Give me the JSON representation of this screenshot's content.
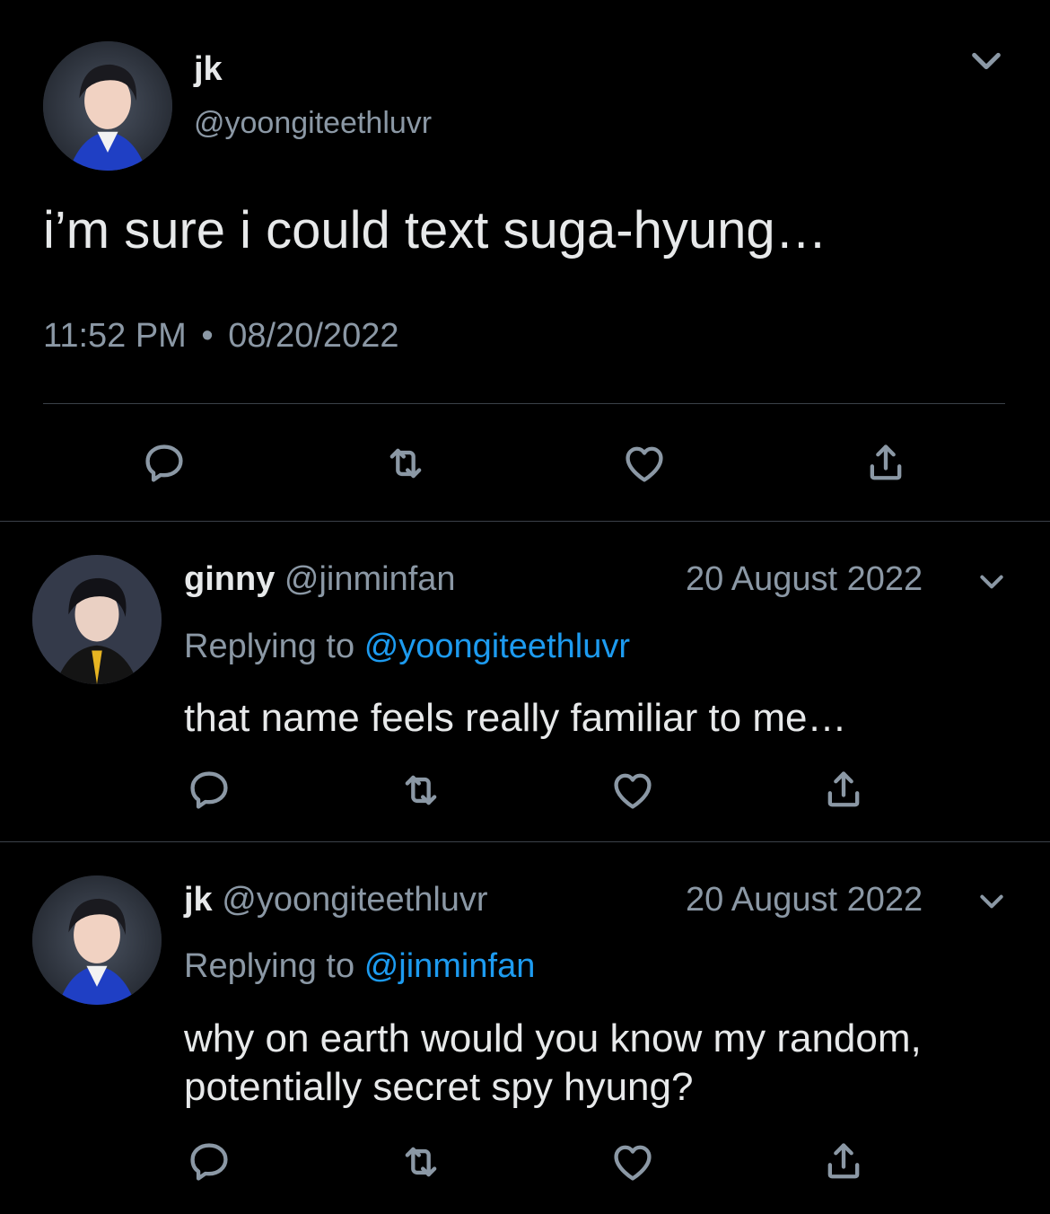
{
  "main_tweet": {
    "name": "jk",
    "handle": "@yoongiteethluvr",
    "text": "i’m sure i could text suga-hyung…",
    "time": "11:52 PM",
    "separator": "•",
    "date": "08/20/2022"
  },
  "replies": [
    {
      "name": "ginny",
      "handle": "@jinminfan",
      "date": "20 August 2022",
      "replying_label": "Replying to",
      "replying_to": "@yoongiteethluvr",
      "text": "that name feels really familiar to me…"
    },
    {
      "name": "jk",
      "handle": "@yoongiteethluvr",
      "date": "20 August 2022",
      "replying_label": "Replying to",
      "replying_to": "@jinminfan",
      "text_line1": "why on earth would you know my random,",
      "text_line2": "potentially secret spy hyung?"
    }
  ],
  "icons": {
    "reply": "reply-icon",
    "retweet": "retweet-icon",
    "like": "heart-icon",
    "share": "share-icon",
    "more": "chevron-down-icon"
  },
  "colors": {
    "background": "#000000",
    "text": "#e7e9ea",
    "muted": "#8b98a5",
    "link": "#1d9bf0",
    "divider": "#3b4149"
  }
}
